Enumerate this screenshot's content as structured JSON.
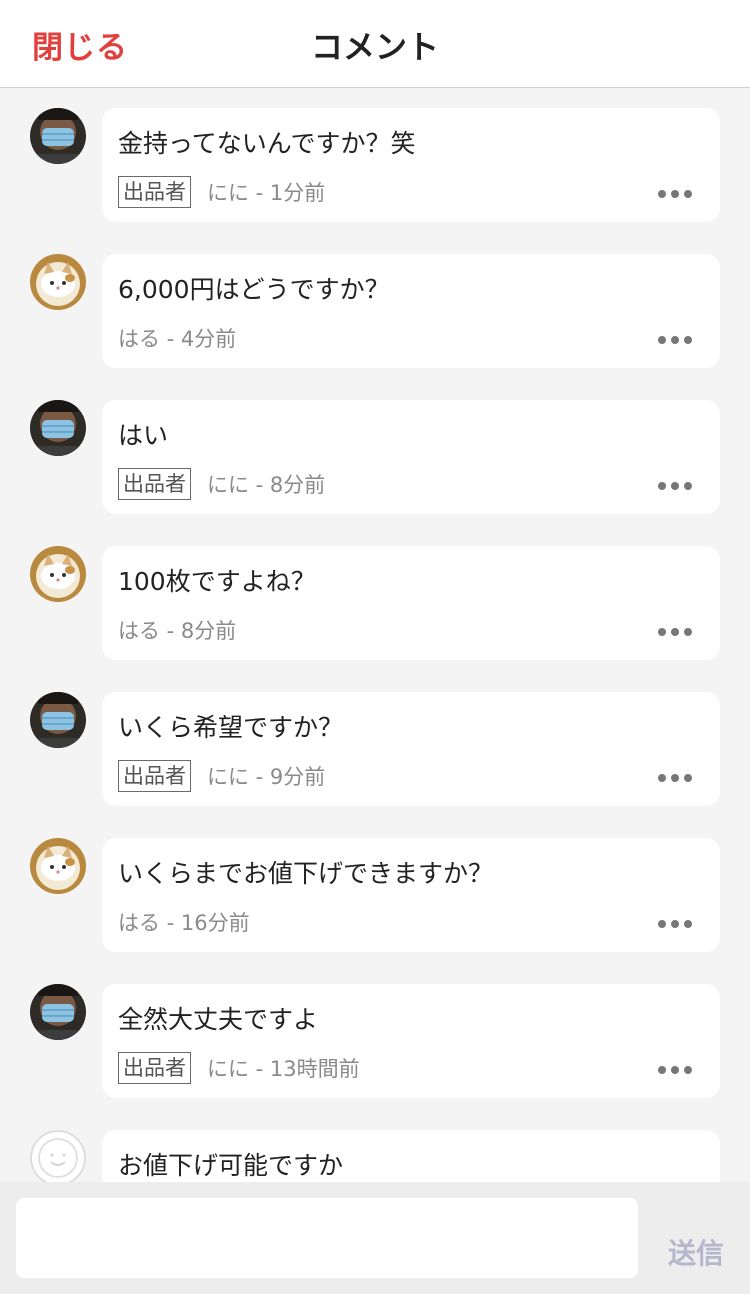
{
  "header": {
    "close_label": "閉じる",
    "title": "コメント"
  },
  "comments": [
    {
      "avatar": "masked-man-avatar",
      "text": "金持ってないんですか？笑",
      "badge": "出品者",
      "meta": "にに - 1分前"
    },
    {
      "avatar": "cat-avatar",
      "text": "6,000円はどうですか？",
      "badge": "",
      "meta": "はる - 4分前"
    },
    {
      "avatar": "masked-man-avatar",
      "text": "はい",
      "badge": "出品者",
      "meta": "にに - 8分前"
    },
    {
      "avatar": "cat-avatar",
      "text": "100枚ですよね？",
      "badge": "",
      "meta": "はる - 8分前"
    },
    {
      "avatar": "masked-man-avatar",
      "text": "いくら希望ですか？",
      "badge": "出品者",
      "meta": "にに - 9分前"
    },
    {
      "avatar": "cat-avatar",
      "text": "いくらまでお値下げできますか？",
      "badge": "",
      "meta": "はる - 16分前"
    },
    {
      "avatar": "masked-man-avatar",
      "text": "全然大丈夫ですよ",
      "badge": "出品者",
      "meta": "にに - 13時間前"
    },
    {
      "avatar": "default-avatar",
      "text": "お値下げ可能ですか",
      "badge": "",
      "meta": ""
    }
  ],
  "footer": {
    "input_value": "",
    "send_label": "送信"
  },
  "colors": {
    "accent": "#e0413d",
    "send_disabled": "#b8b6cc",
    "background": "#f4f4f4"
  }
}
